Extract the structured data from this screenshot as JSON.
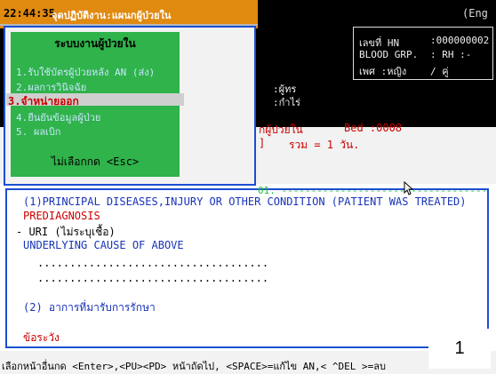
{
  "header": {
    "clock": "22:44:35",
    "menu_title": "จุดปฏิบัติงาน:แผนกผู้ป่วยใน",
    "top_right": "(Eng"
  },
  "menu": {
    "title": "ระบบงานผู้ป่วยใน",
    "items": [
      "1.รับใช้บัตรผู้ป่วยหลัง AN (ส่ง)",
      "2.ผลการวินิจฉัย",
      "3.จำหน่ายออก",
      "4.ยืนยันข้อมูลผู้ป่วย",
      "5.   ผลเบิก"
    ],
    "selected_index": 2,
    "footer": "ไม่เลือกกด <Esc>"
  },
  "patient": {
    "hn_label": "เลขที่ HN",
    "hn_value": ":000000002",
    "blood_label": "BLOOD GRP.",
    "blood_value": ":    RH :-",
    "sex_label": "เพศ :หญิง",
    "sex_value": "/ คู่"
  },
  "mid": {
    "line1": ":ผู้ทร",
    "line2": ":กำไร่"
  },
  "ward": {
    "label": "กผู้ป่วยใน",
    "bed": "Bed :0008",
    "bracket": "]",
    "total": "รวม =   1  วัน."
  },
  "diagnosis": {
    "section_number": "01.",
    "heading": "(1)PRINCIPAL DISEASES,INJURY OR OTHER CONDITION (PATIENT WAS TREATED)",
    "prediagnosis_label": "PREDIAGNOSIS",
    "prediagnosis_value": "- URI (ไม่ระบุเชื้อ)",
    "underlying_label": "UNDERLYING CAUSE OF ABOVE",
    "dots1": "....................................",
    "dots2": "....................................",
    "section2": "(2) อาการที่มารับการรักษา",
    "caution": "ข้อระวัง"
  },
  "footer": {
    "help": "เลือกหน้าอื่นกด <Enter>,<PU><PD> หน้าถัดไป, <SPACE>=แก้ไข AN,< ^DEL >=ลบ",
    "page_number": "1"
  },
  "colors": {
    "top_band": "#000000",
    "orange_bar": "#e08a10",
    "menu_green": "#2fb34a",
    "frame_blue": "#1a4fd0"
  }
}
